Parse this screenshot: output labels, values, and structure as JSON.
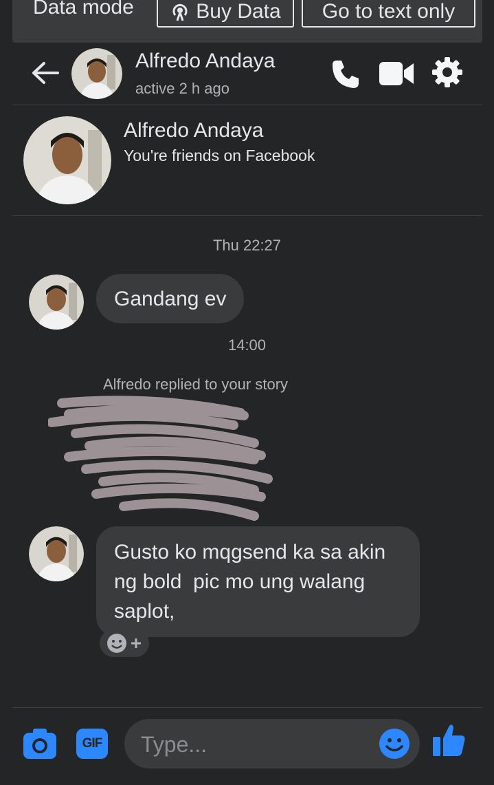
{
  "data_bar": {
    "mode_label": "Data mode",
    "buy_data_label": "Buy Data",
    "text_only_label": "Go to text only"
  },
  "header": {
    "name": "Alfredo Andaya",
    "status": "active 2 h ago",
    "icons": [
      "back-arrow-icon",
      "phone-icon",
      "video-camera-icon",
      "gear-icon"
    ]
  },
  "profile": {
    "name": "Alfredo Andaya",
    "subtitle": "You're friends on Facebook"
  },
  "conversation": {
    "timestamp_1": "Thu 22:27",
    "message_1": "Gandang ev",
    "timestamp_2": "14:00",
    "story_reply_label": "Alfredo replied to your story",
    "message_2_lines": [
      "Gusto ko mqgsend ka sa akin",
      "ng bold  pic mo ung walang",
      "saplot,"
    ]
  },
  "composer": {
    "placeholder": "Type...",
    "gif_label": "GIF",
    "icons": [
      "camera-icon",
      "gif-icon",
      "emoji-icon",
      "thumbs-up-icon"
    ]
  },
  "colors": {
    "background": "#242526",
    "bubble": "#3a3b3c",
    "accent": "#2d88ff",
    "text": "#e4e6eb",
    "muted": "#b0b3b8"
  }
}
